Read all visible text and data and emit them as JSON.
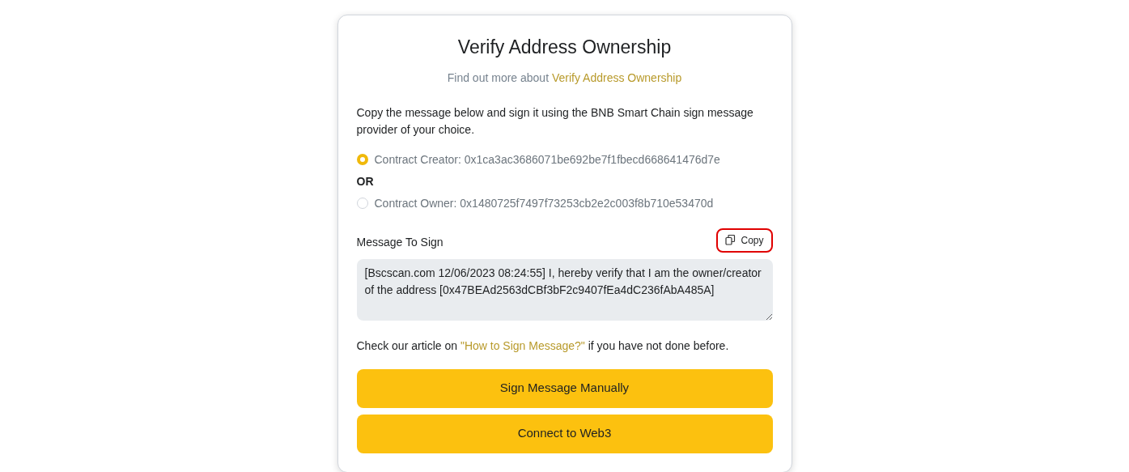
{
  "title": "Verify Address Ownership",
  "subtitle": {
    "prefix": "Find out more about",
    "link": "Verify Address Ownership"
  },
  "instructions": "Copy the message below and sign it using the BNB Smart Chain sign message provider of your choice.",
  "options": [
    {
      "label": "Contract Creator: 0x1ca3ac3686071be692be7f1fbecd668641476d7e",
      "selected": true
    },
    {
      "label": "Contract Owner: 0x1480725f7497f73253cb2e2c003f8b710e53470d",
      "selected": false
    }
  ],
  "separator": "OR",
  "message": {
    "label": "Message To Sign",
    "copy_button": {
      "label": "Copy",
      "highlighted": true
    },
    "value": "[Bscscan.com 12/06/2023 08:24:55] I, hereby verify that I am the owner/creator of the address [0x47BEAd2563dCBf3bF2c9407fEa4dC236fAbA485A]"
  },
  "article_note": {
    "prefix": "Check our article on",
    "link": "\"How to Sign Message?\"",
    "suffix": "if you have not done before."
  },
  "buttons": [
    "Sign Message Manually",
    "Connect to Web3"
  ]
}
